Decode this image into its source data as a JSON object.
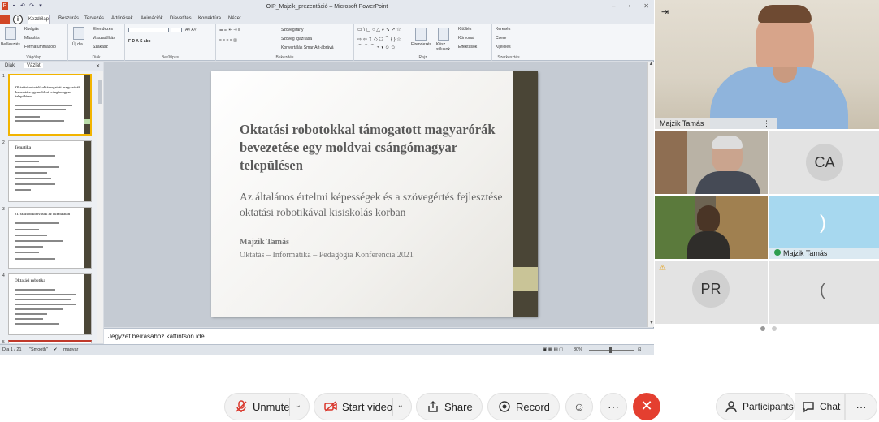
{
  "ppt": {
    "window_title": "OIP_Majzik_prezentáció  –  Microsoft PowerPoint",
    "tabs": [
      "Kezdőlap",
      "Beszúrás",
      "Tervezés",
      "Áttűnések",
      "Animációk",
      "Diavetítés",
      "Korrektúra",
      "Nézet"
    ],
    "active_tab": "Kezdőlap",
    "ribbon_groups": {
      "clipboard": {
        "label": "Vágólap",
        "paste": "Beillesztés",
        "cut": "Kivágás",
        "copy": "Másolás",
        "format": "Formátummásoló"
      },
      "slides": {
        "label": "Diák",
        "new": "Új dia",
        "layout": "Elrendezés",
        "reset": "Visszaállítás",
        "section": "Szakasz"
      },
      "font": {
        "label": "Betűtípus"
      },
      "paragraph": {
        "label": "Bekezdés",
        "text_direction": "Szövegirány",
        "align_text": "Szöveg igazítása",
        "smartart": "Konvertálás SmartArt-ábrává"
      },
      "drawing": {
        "label": "Rajz",
        "arrange": "Elrendezés",
        "quick_styles": "Kész stílusok",
        "fill": "Kitöltés",
        "outline": "Körvonal",
        "effects": "Effektusok"
      },
      "editing": {
        "label": "Szerkesztés",
        "find": "Keresés",
        "replace": "Csere",
        "select": "Kijelölés"
      }
    },
    "panel_tabs": [
      "Diák",
      "Vázlat"
    ],
    "thumbnails": [
      {
        "num": "1",
        "title": "Oktatási robotokkal támogatott magyarórák bevezetése egy moldvai csángómagyar településen"
      },
      {
        "num": "2",
        "title": "Tematika"
      },
      {
        "num": "3",
        "title": "21. századi kihívások az oktatásban"
      },
      {
        "num": "4",
        "title": "Oktatási robotika"
      },
      {
        "num": "5",
        "title": ""
      }
    ],
    "slide": {
      "title": "Oktatási robotokkal támogatott magyarórák bevezetése egy moldvai csángómagyar településen",
      "subtitle": "Az általános értelmi képességek és a szövegértés fejlesztése oktatási robotikával kisiskolás korban",
      "author": "Majzik Tamás",
      "conference": "Oktatás – Informatika – Pedagógia Konferencia 2021"
    },
    "notes_placeholder": "Jegyzet beírásához kattintson ide",
    "status": {
      "slide_info": "Dia 1 / 21",
      "theme": "\"Smooth\"",
      "language": "magyar",
      "zoom": "80%"
    }
  },
  "videos": {
    "main": {
      "name": "Majzik Tamás"
    },
    "tiles": [
      {
        "type": "video",
        "name": ""
      },
      {
        "type": "avatar",
        "initials": "CA"
      },
      {
        "type": "video",
        "name": ""
      },
      {
        "type": "audio",
        "name": "Majzik Tamás"
      },
      {
        "type": "avatar",
        "initials": "PR"
      },
      {
        "type": "loading",
        "name": ""
      }
    ]
  },
  "controls": {
    "unmute": "Unmute",
    "start_video": "Start video",
    "share": "Share",
    "record": "Record",
    "more": "···",
    "participants": "Participants",
    "chat": "Chat",
    "more_right": "···"
  },
  "colors": {
    "end_call": "#e43f30",
    "ppt_file_tab": "#d24726",
    "slide_bar": "#4a4536"
  }
}
